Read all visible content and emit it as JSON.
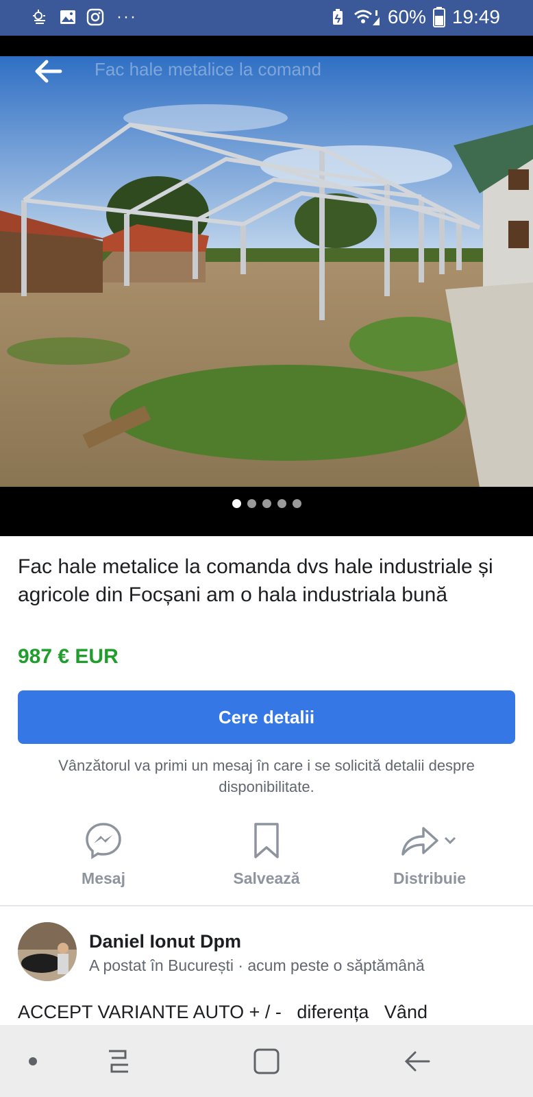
{
  "status_bar": {
    "battery_percent": "60%",
    "time": "19:49",
    "left_icons": [
      "weather-icon",
      "gallery-icon",
      "instagram-icon"
    ],
    "more": "···"
  },
  "media": {
    "watermark": "Fac hale metalice la comand",
    "page_count": 5,
    "active_page": 1
  },
  "listing": {
    "title": "Fac hale metalice la comanda dvs hale industriale și agricole din Focșani am o hala industriala bună",
    "price": "987 € EUR",
    "price_color": "#1f9e2c",
    "cta_label": "Cere detalii",
    "cta_color": "#3578e5",
    "cta_note": "Vânzătorul va primi un mesaj în care i se solicită detalii despre disponibilitate."
  },
  "actions": [
    {
      "label": "Mesaj",
      "icon": "messenger-icon"
    },
    {
      "label": "Salvează",
      "icon": "bookmark-icon"
    },
    {
      "label": "Distribuie",
      "icon": "share-icon"
    }
  ],
  "seller": {
    "name": "Daniel Ionut Dpm",
    "meta": "A postat în București · acum peste o săptămână"
  },
  "description_preview": "ACCEPT VARIANTE AUTO + / -   diferența   Vând",
  "nav": [
    "recent-apps-icon",
    "home-icon",
    "back-icon"
  ]
}
